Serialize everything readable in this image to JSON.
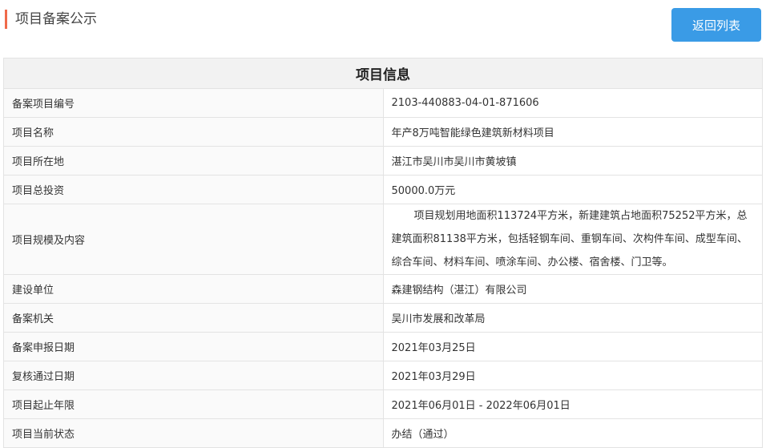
{
  "header": {
    "title": "项目备案公示",
    "back_button_label": "返回列表"
  },
  "table": {
    "title": "项目信息",
    "rows": [
      {
        "label": "备案项目编号",
        "value": "2103-440883-04-01-871606"
      },
      {
        "label": "项目名称",
        "value": "年产8万吨智能绿色建筑新材料项目"
      },
      {
        "label": "项目所在地",
        "value": "湛江市吴川市吴川市黄坡镇"
      },
      {
        "label": "项目总投资",
        "value": "50000.0万元"
      },
      {
        "label": "项目规模及内容",
        "value": "项目规划用地面积113724平方米，新建建筑占地面积75252平方米，总建筑面积81138平方米，包括轻钢车间、重钢车间、次构件车间、成型车间、综合车间、材料车间、喷涂车间、办公楼、宿舍楼、门卫等。"
      },
      {
        "label": "建设单位",
        "value": "森建钢结构（湛江）有限公司"
      },
      {
        "label": "备案机关",
        "value": "吴川市发展和改革局"
      },
      {
        "label": "备案申报日期",
        "value": "2021年03月25日"
      },
      {
        "label": "复核通过日期",
        "value": "2021年03月29日"
      },
      {
        "label": "项目起止年限",
        "value": "2021年06月01日 - 2022年06月01日"
      },
      {
        "label": "项目当前状态",
        "value": "办结（通过）"
      }
    ]
  },
  "colors": {
    "accent": "#f06a4a",
    "button": "#3a9be6"
  }
}
